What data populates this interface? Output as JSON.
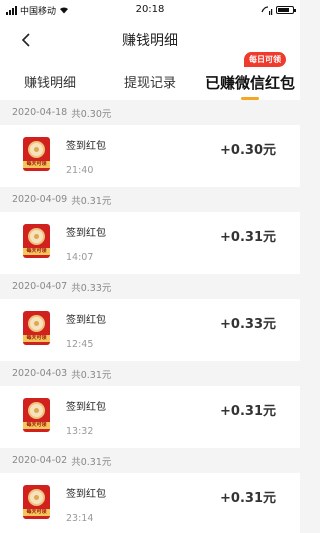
{
  "status_bar": {
    "carrier": "中国移动",
    "time": "20:18"
  },
  "nav": {
    "title": "赚钱明细"
  },
  "tabs": [
    {
      "label": "赚钱明细",
      "active": false
    },
    {
      "label": "提现记录",
      "active": false
    },
    {
      "label": "已赚微信红包",
      "active": true,
      "badge": "每日可领"
    }
  ],
  "records": [
    {
      "date": "2020-04-18",
      "total": "共0.30元",
      "title": "签到红包",
      "time": "21:40",
      "amount": "+0.30元",
      "icon_label": "每天可领"
    },
    {
      "date": "2020-04-09",
      "total": "共0.31元",
      "title": "签到红包",
      "time": "14:07",
      "amount": "+0.31元",
      "icon_label": "每天可领"
    },
    {
      "date": "2020-04-07",
      "total": "共0.33元",
      "title": "签到红包",
      "time": "12:45",
      "amount": "+0.33元",
      "icon_label": "每天可领"
    },
    {
      "date": "2020-04-03",
      "total": "共0.31元",
      "title": "签到红包",
      "time": "13:32",
      "amount": "+0.31元",
      "icon_label": "每天可领"
    },
    {
      "date": "2020-04-02",
      "total": "共0.31元",
      "title": "签到红包",
      "time": "23:14",
      "amount": "+0.31元",
      "icon_label": "每天可领"
    }
  ],
  "colors": {
    "accent": "#f5a623",
    "badge": "#ee3b2e",
    "icon_red": "#d0211f"
  }
}
